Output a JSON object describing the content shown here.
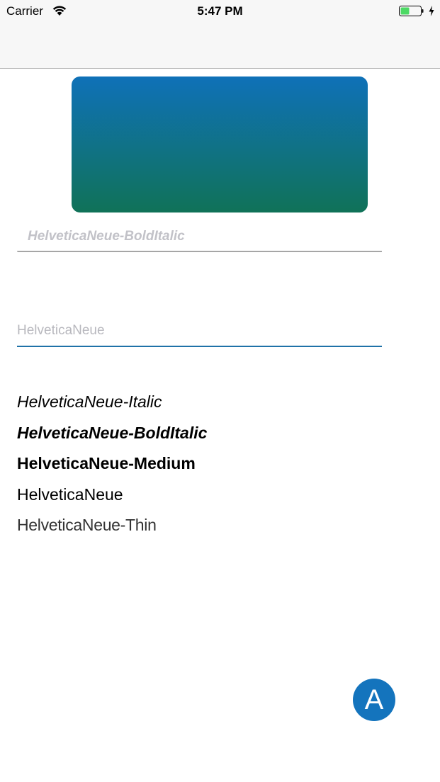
{
  "status_bar": {
    "carrier": "Carrier",
    "time": "5:47 PM",
    "icons": [
      "wifi-icon",
      "battery-icon",
      "charging-icon"
    ]
  },
  "colors": {
    "gradient_top": "#0f71b8",
    "gradient_bottom": "#107258",
    "accent": "#1474bd",
    "field_underline_active": "#1f72a8"
  },
  "field1": {
    "placeholder": "HelveticaNeue-BoldItalic"
  },
  "field2": {
    "placeholder": "HelveticaNeue"
  },
  "font_list": [
    "HelveticaNeue-Italic",
    "HelveticaNeue-BoldItalic",
    "HelveticaNeue-Medium",
    "HelveticaNeue",
    "HelveticaNeue-Thin"
  ],
  "fab": {
    "label": "A"
  }
}
